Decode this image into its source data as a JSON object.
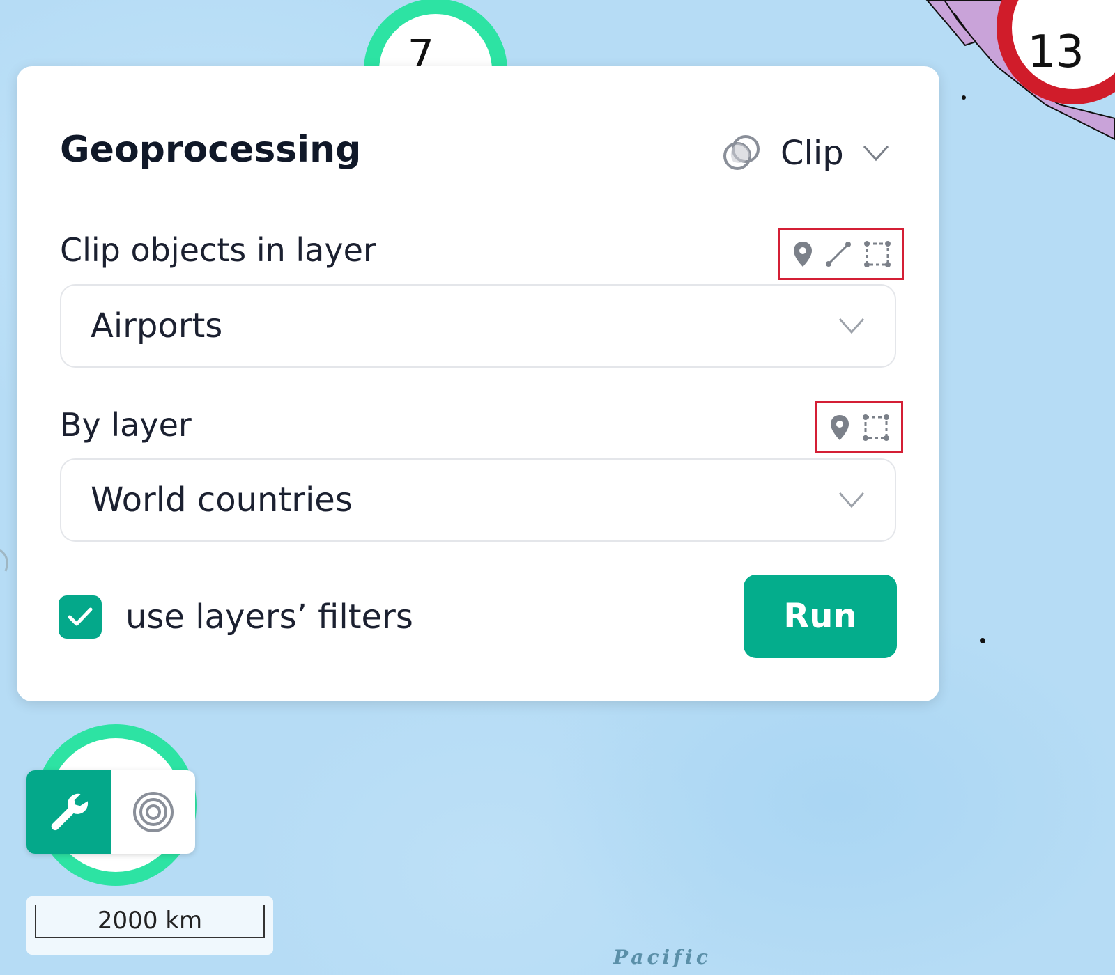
{
  "map": {
    "ocean_label": "Pacific",
    "clusters": [
      {
        "count": "7",
        "colors": [
          "#e02030",
          "#2de3a3"
        ]
      },
      {
        "count": "13",
        "colors": [
          "#d01c2a"
        ]
      }
    ],
    "scale": "2000 km"
  },
  "panel": {
    "title": "Geoprocessing",
    "operation": {
      "label": "Clip",
      "icon": "intersect-circles-icon"
    },
    "clip_field": {
      "label": "Clip objects in layer",
      "geometry_icons": [
        "point-icon",
        "line-icon",
        "polygon-icon"
      ],
      "value": "Airports"
    },
    "by_field": {
      "label": "By layer",
      "geometry_icons": [
        "point-icon",
        "polygon-icon"
      ],
      "value": "World countries"
    },
    "use_filters": {
      "label": "use layers’ filters",
      "checked": true
    },
    "run_label": "Run"
  },
  "toolbar": {
    "items": [
      {
        "icon": "wrench-icon",
        "active": true
      },
      {
        "icon": "target-icon",
        "active": false
      }
    ]
  },
  "colors": {
    "accent": "#04a88a",
    "highlight_border": "#d41f35",
    "ocean": "#b6dcf5",
    "land": "#c9a3d9"
  }
}
